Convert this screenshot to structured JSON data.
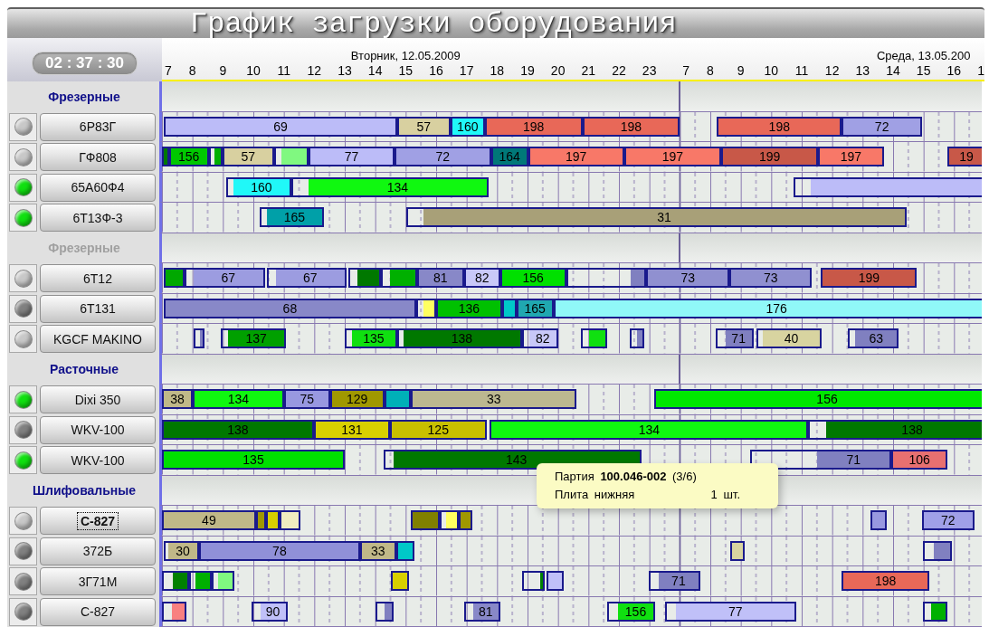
{
  "window": {
    "title": "График загрузки оборудования"
  },
  "clock": "02 : 37 : 30",
  "timeline": {
    "days": [
      {
        "date": "Вторник, 12.05.2009",
        "hours": [
          "7",
          "8",
          "9",
          "10",
          "11",
          "12",
          "13",
          "14",
          "15",
          "16",
          "17",
          "18",
          "19",
          "20",
          "21",
          "22",
          "23"
        ]
      },
      {
        "date": "Среда, 13.05.200",
        "hours": [
          "7",
          "8",
          "9",
          "10",
          "11",
          "12",
          "13",
          "14",
          "15",
          "16",
          "1"
        ]
      }
    ]
  },
  "groups": [
    {
      "title": "Фрезерные",
      "dimmed": false,
      "machines": [
        {
          "name": "6Р83Г",
          "color": "#c8c8c8",
          "focused": false,
          "bars": [
            {
              "label": "69",
              "color": "#bcbcf8"
            },
            {
              "label": "57",
              "color": "#d8d0a0"
            },
            {
              "label": "160",
              "color": "#20f8f8"
            },
            {
              "label": "198",
              "color": "#e86858"
            },
            {
              "label": "198",
              "color": "#e86858"
            },
            {
              "label": "198",
              "color": "#e86858"
            },
            {
              "label": "72",
              "color": "#a0a0e4"
            }
          ]
        },
        {
          "name": "ГФ808",
          "color": "#c8c8c8",
          "focused": false,
          "bars": [
            {
              "color": "#007800"
            },
            {
              "label": "156",
              "color": "#00c800"
            },
            {
              "color": "#00b000"
            },
            {
              "label": "57",
              "color": "#d8d0a0"
            },
            {
              "color": "#80f880"
            },
            {
              "label": "77",
              "color": "#bcbcf8"
            },
            {
              "label": "72",
              "color": "#a0a0e4"
            },
            {
              "label": "164",
              "color": "#007878"
            },
            {
              "label": "197",
              "color": "#f87868"
            },
            {
              "label": "197",
              "color": "#f87868"
            },
            {
              "label": "199",
              "color": "#c85848"
            },
            {
              "label": "197",
              "color": "#f87868"
            },
            {
              "label": "19",
              "color": "#c85848"
            }
          ]
        },
        {
          "name": "65А60Ф4",
          "color": "#10e010",
          "focused": false,
          "bars": [
            {
              "label": "160",
              "color": "#20f8f8"
            },
            {
              "label": "134",
              "color": "#10f810"
            },
            {
              "color": "#bcbcf8"
            }
          ]
        },
        {
          "name": "6Т13Ф-3",
          "color": "#10e010",
          "focused": false,
          "bars": [
            {
              "label": "165",
              "color": "#00a0a8"
            },
            {
              "label": "31",
              "color": "#a8a078"
            }
          ]
        }
      ]
    },
    {
      "title": "Фрезерные",
      "dimmed": true,
      "machines": [
        {
          "name": "6Т12",
          "color": "#c8c8c8",
          "focused": false,
          "bars": [
            {
              "color": "#00a800"
            },
            {
              "label": "67",
              "color": "#9c9ce0"
            },
            {
              "label": "67",
              "color": "#9c9ce0"
            },
            {
              "color": "#007800"
            },
            {
              "color": "#00b000"
            },
            {
              "label": "81",
              "color": "#8888c8"
            },
            {
              "label": "82",
              "color": "#c8c8f8"
            },
            {
              "label": "156",
              "color": "#00e000"
            },
            {
              "color": "#8080c0"
            },
            {
              "label": "73",
              "color": "#9090d0"
            },
            {
              "label": "73",
              "color": "#9090d0"
            },
            {
              "label": "199",
              "color": "#c85848"
            }
          ]
        },
        {
          "name": "6Т131",
          "color": "#808080",
          "focused": false,
          "bars": [
            {
              "label": "68",
              "color": "#8888c8"
            },
            {
              "color": "#ffff60"
            },
            {
              "label": "136",
              "color": "#00c000"
            },
            {
              "color": "#00c8c8"
            },
            {
              "label": "165",
              "color": "#20a8b0"
            },
            {
              "label": "176",
              "color": "#90f8f8"
            }
          ]
        },
        {
          "name": "KGCF MAKINO",
          "color": "#c8c8c8",
          "focused": false,
          "bars": [
            {
              "color": "#8080c0"
            },
            {
              "label": "137",
              "color": "#00a000"
            },
            {
              "label": "135",
              "color": "#10e010"
            },
            {
              "label": "138",
              "color": "#007800"
            },
            {
              "label": "82",
              "color": "#c8c8f8"
            },
            {
              "color": "#10e010"
            },
            {
              "color": "#8080c0"
            },
            {
              "label": "71",
              "color": "#8080c0"
            },
            {
              "label": "40",
              "color": "#d8d4a0"
            },
            {
              "label": "63",
              "color": "#8080c0"
            }
          ]
        }
      ]
    },
    {
      "title": "Расточные",
      "dimmed": false,
      "machines": [
        {
          "name": "Dixi 350",
          "color": "#10e010",
          "focused": false,
          "bars": [
            {
              "label": "38",
              "color": "#c0b888"
            },
            {
              "label": "134",
              "color": "#10f810"
            },
            {
              "label": "75",
              "color": "#9898e0"
            },
            {
              "label": "129",
              "color": "#a09800"
            },
            {
              "color": "#00b0b8"
            },
            {
              "label": "33",
              "color": "#bcb890"
            },
            {
              "label": "156",
              "color": "#00e800"
            }
          ]
        },
        {
          "name": "WKV-100",
          "color": "#808080",
          "focused": false,
          "bars": [
            {
              "label": "138",
              "color": "#007800"
            },
            {
              "label": "131",
              "color": "#d8d000"
            },
            {
              "label": "125",
              "color": "#c8c000"
            },
            {
              "label": "134",
              "color": "#10f810"
            },
            {
              "label": "138",
              "color": "#007800"
            }
          ]
        },
        {
          "name": "WKV-100",
          "color": "#10e010",
          "focused": false,
          "bars": [
            {
              "label": "135",
              "color": "#00e000"
            },
            {
              "label": "143",
              "color": "#007800"
            },
            {
              "label": "71",
              "color": "#8080c0"
            },
            {
              "label": "106",
              "color": "#e87070"
            }
          ]
        }
      ]
    },
    {
      "title": "Шлифовальные",
      "dimmed": false,
      "machines": [
        {
          "name": "С-827",
          "color": "#c8c8c8",
          "focused": true,
          "bars": [
            {
              "label": "49",
              "color": "#c0b888"
            },
            {
              "color": "#a09800"
            },
            {
              "color": "#d8d000"
            },
            {
              "color": "#f0ecc0"
            },
            {
              "color": "#808000"
            },
            {
              "color": "#ffff60"
            },
            {
              "color": "#a09800"
            },
            {
              "color": "#9898e0"
            },
            {
              "label": "72",
              "color": "#a0a0e8"
            }
          ]
        },
        {
          "name": "372Б",
          "color": "#808080",
          "focused": false,
          "bars": [
            {
              "label": "30",
              "color": "#c0b888"
            },
            {
              "label": "78",
              "color": "#9090d8"
            },
            {
              "label": "33",
              "color": "#c0b888"
            },
            {
              "color": "#00c8c8"
            },
            {
              "color": "#d8d4a0"
            },
            {
              "color": "#8080c0"
            }
          ]
        },
        {
          "name": "3Г71М",
          "color": "#808080",
          "focused": false,
          "bars": [
            {
              "color": "#008000"
            },
            {
              "color": "#00b000"
            },
            {
              "color": "#80f880"
            },
            {
              "color": "#d8d000"
            },
            {
              "color": "#008000"
            },
            {
              "color": "#c0c0f8"
            },
            {
              "label": "71",
              "color": "#8080c0"
            },
            {
              "label": "198",
              "color": "#e86858"
            }
          ]
        },
        {
          "name": "С-827",
          "color": "#808080",
          "focused": false,
          "bars": [
            {
              "color": "#f88080"
            },
            {
              "label": "90",
              "color": "#c0c0f8"
            },
            {
              "color": "#8080c0"
            },
            {
              "label": "81",
              "color": "#8888c8"
            },
            {
              "label": "156",
              "color": "#10e010"
            },
            {
              "label": "77",
              "color": "#c0c0f8"
            },
            {
              "color": "#00b000"
            }
          ]
        }
      ]
    }
  ],
  "tooltip": {
    "batch": "Партия **100.046-002** (3/6)",
    "part": "Плита нижняя",
    "quantity": "1 шт."
  }
}
